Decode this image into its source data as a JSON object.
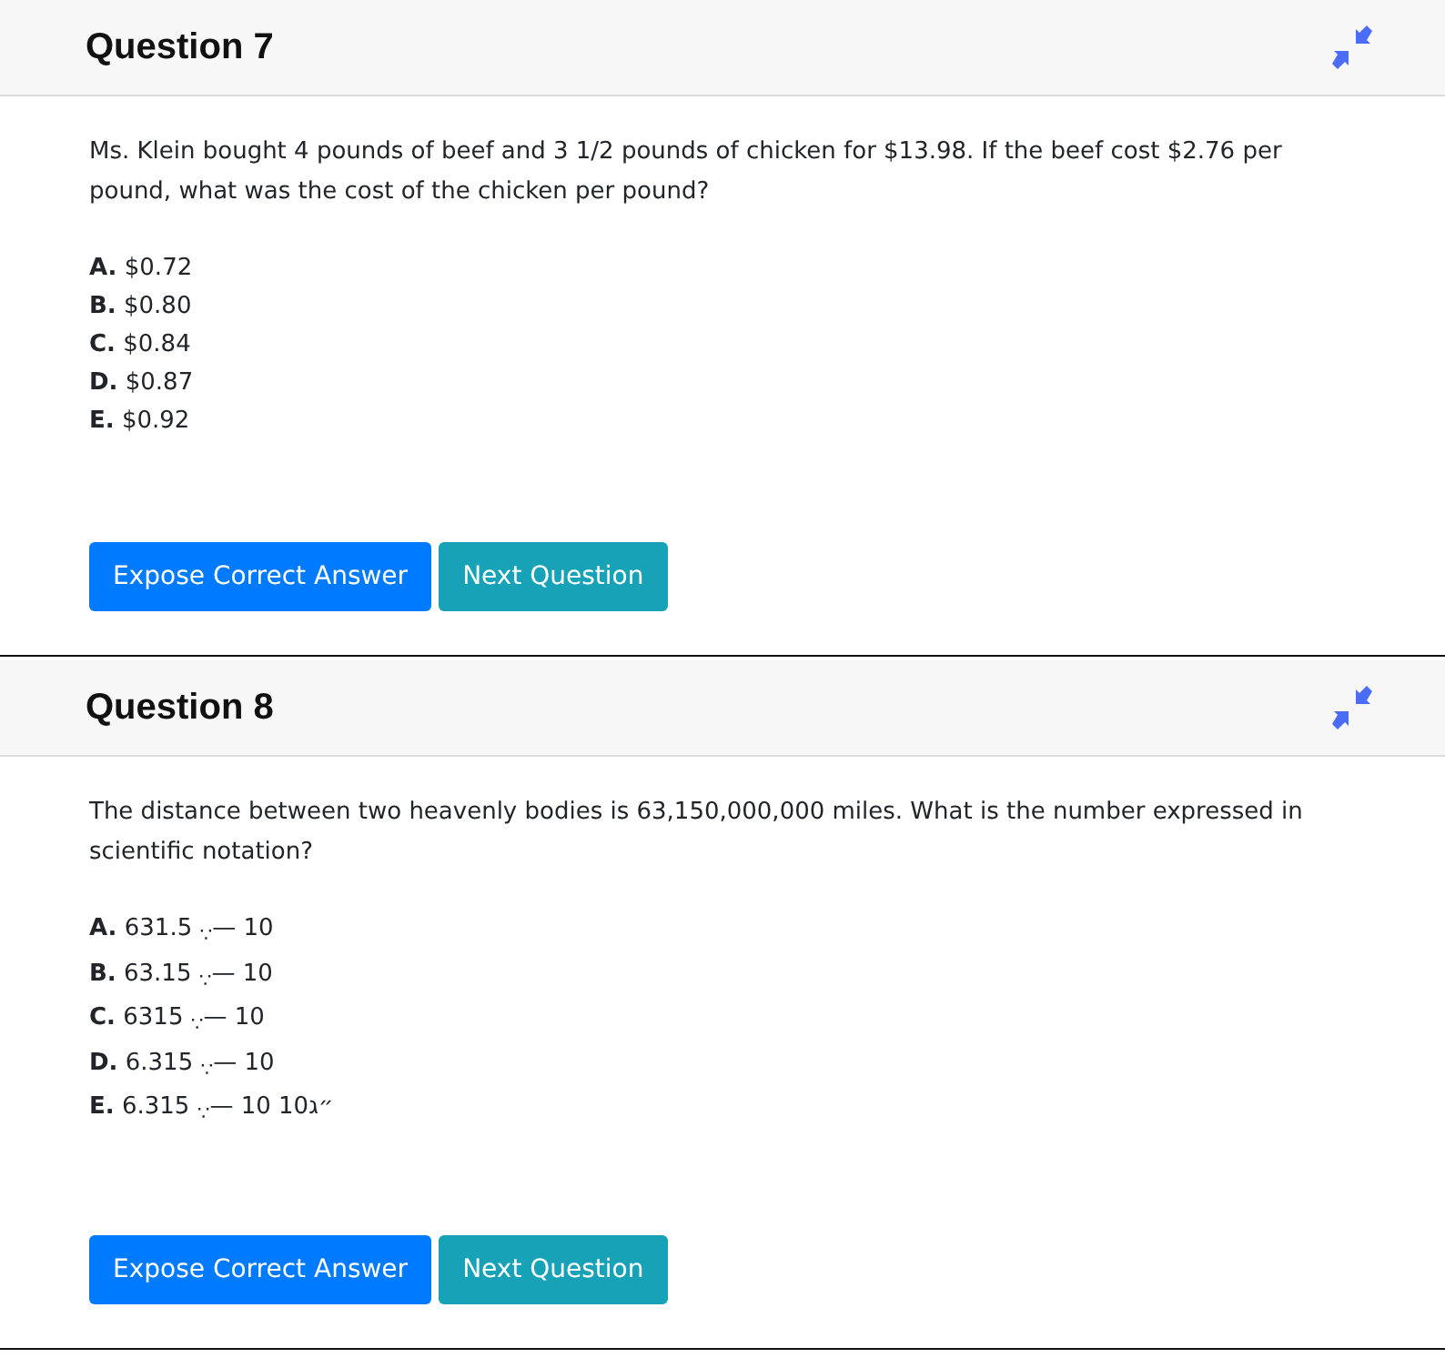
{
  "questions": [
    {
      "title": "Question 7",
      "text": "Ms. Klein bought 4 pounds of beef and 3 1/2 pounds of chicken for $13.98. If the beef cost $2.76 per pound, what was the cost of the chicken per pound?",
      "options": [
        {
          "letter": "A.",
          "text": "$0.72"
        },
        {
          "letter": "B.",
          "text": "$0.80"
        },
        {
          "letter": "C.",
          "text": "$0.84"
        },
        {
          "letter": "D.",
          "text": "$0.87"
        },
        {
          "letter": "E.",
          "text": "$0.92"
        }
      ],
      "buttons": [
        {
          "kind": "primary",
          "label": "Expose Correct Answer"
        },
        {
          "kind": "info",
          "label": "Next Question"
        }
      ]
    },
    {
      "title": "Question 8",
      "text": "The distance between two heavenly bodies is 63,150,000,000 miles. What is the number expressed in scientific notation?",
      "options": [
        {
          "letter": "A.",
          "text": "631.5 $_{∵}$— 10"
        },
        {
          "letter": "B.",
          "text": "63.15 $_{∵}$— 10"
        },
        {
          "letter": "C.",
          "text": "6315 $_{∵}$— 10"
        },
        {
          "letter": "D.",
          "text": "6.315 $_{∵}$— 10"
        },
        {
          "letter": "E.",
          "text": "6.315 $_{∵}$— 10 10״ג"
        }
      ],
      "buttons": [
        {
          "kind": "primary",
          "label": "Expose Correct Answer"
        },
        {
          "kind": "info",
          "label": "Next Question"
        }
      ]
    }
  ]
}
